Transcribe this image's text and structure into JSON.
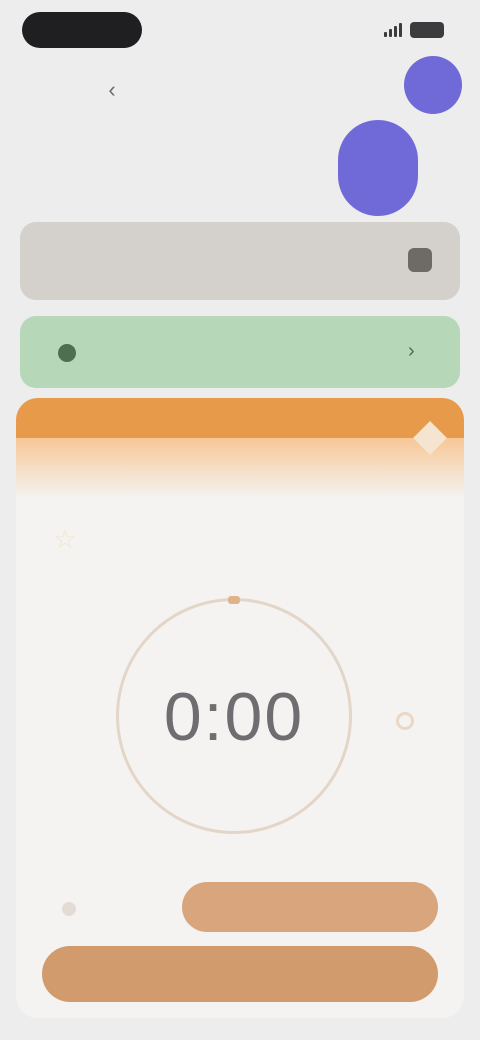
{
  "status_bar": {
    "time": ""
  },
  "header": {
    "title": ""
  },
  "cards": {
    "gray": {
      "text": ""
    },
    "green": {
      "text": ""
    }
  },
  "timer": {
    "tabs": [],
    "session_label": "",
    "time": "0:00",
    "secondary_button": "",
    "primary_button": ""
  },
  "colors": {
    "accent_purple": "#6f6ad8",
    "panel_orange": "#e69a4a",
    "button_tan": "#d29b6e",
    "green_card": "#b6d8b9",
    "gray_card": "#d4d0cc"
  },
  "icons": {
    "back": "chevron-left-icon",
    "signal": "signal-icon",
    "battery": "battery-icon",
    "star": "star-icon"
  }
}
